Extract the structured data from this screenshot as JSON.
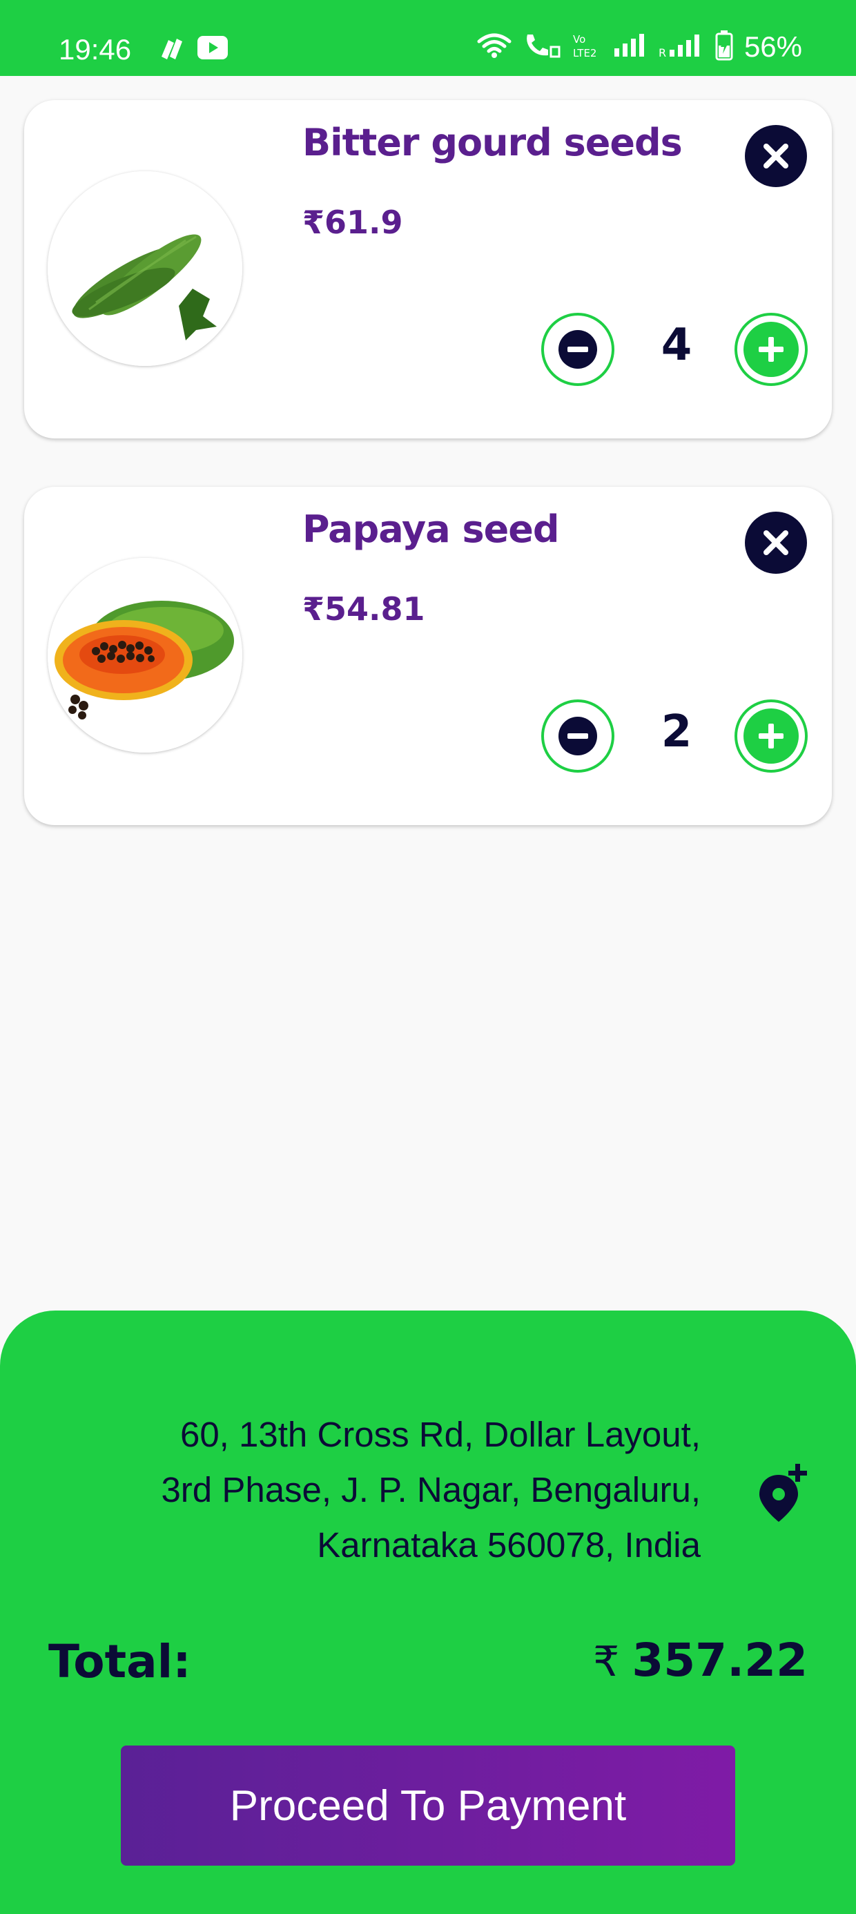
{
  "status_bar": {
    "time": "19:46",
    "battery": "56%",
    "icons": [
      "pinwheel-icon",
      "youtube-icon",
      "wifi-icon",
      "wifi-call-icon",
      "volte-icon",
      "signal-icon",
      "signal-roaming-icon",
      "battery-charging-icon"
    ]
  },
  "cart": {
    "items": [
      {
        "name": "Bitter gourd seeds",
        "price": "₹61.9",
        "quantity": "4",
        "image": "bitter-gourd-image"
      },
      {
        "name": "Papaya seed",
        "price": "₹54.81",
        "quantity": "2",
        "image": "papaya-image"
      }
    ]
  },
  "checkout": {
    "address_line1": "60, 13th Cross Rd, Dollar Layout,",
    "address_line2": "3rd Phase, J. P. Nagar, Bengaluru,",
    "address_line3": "Karnataka 560078, India",
    "total_label": "Total:",
    "currency": "₹",
    "total_value": "357.22",
    "pay_button": "Proceed To Payment"
  },
  "colors": {
    "primary_green": "#1ecf44",
    "navy": "#0b0b36",
    "purple": "#5a1f8e"
  }
}
